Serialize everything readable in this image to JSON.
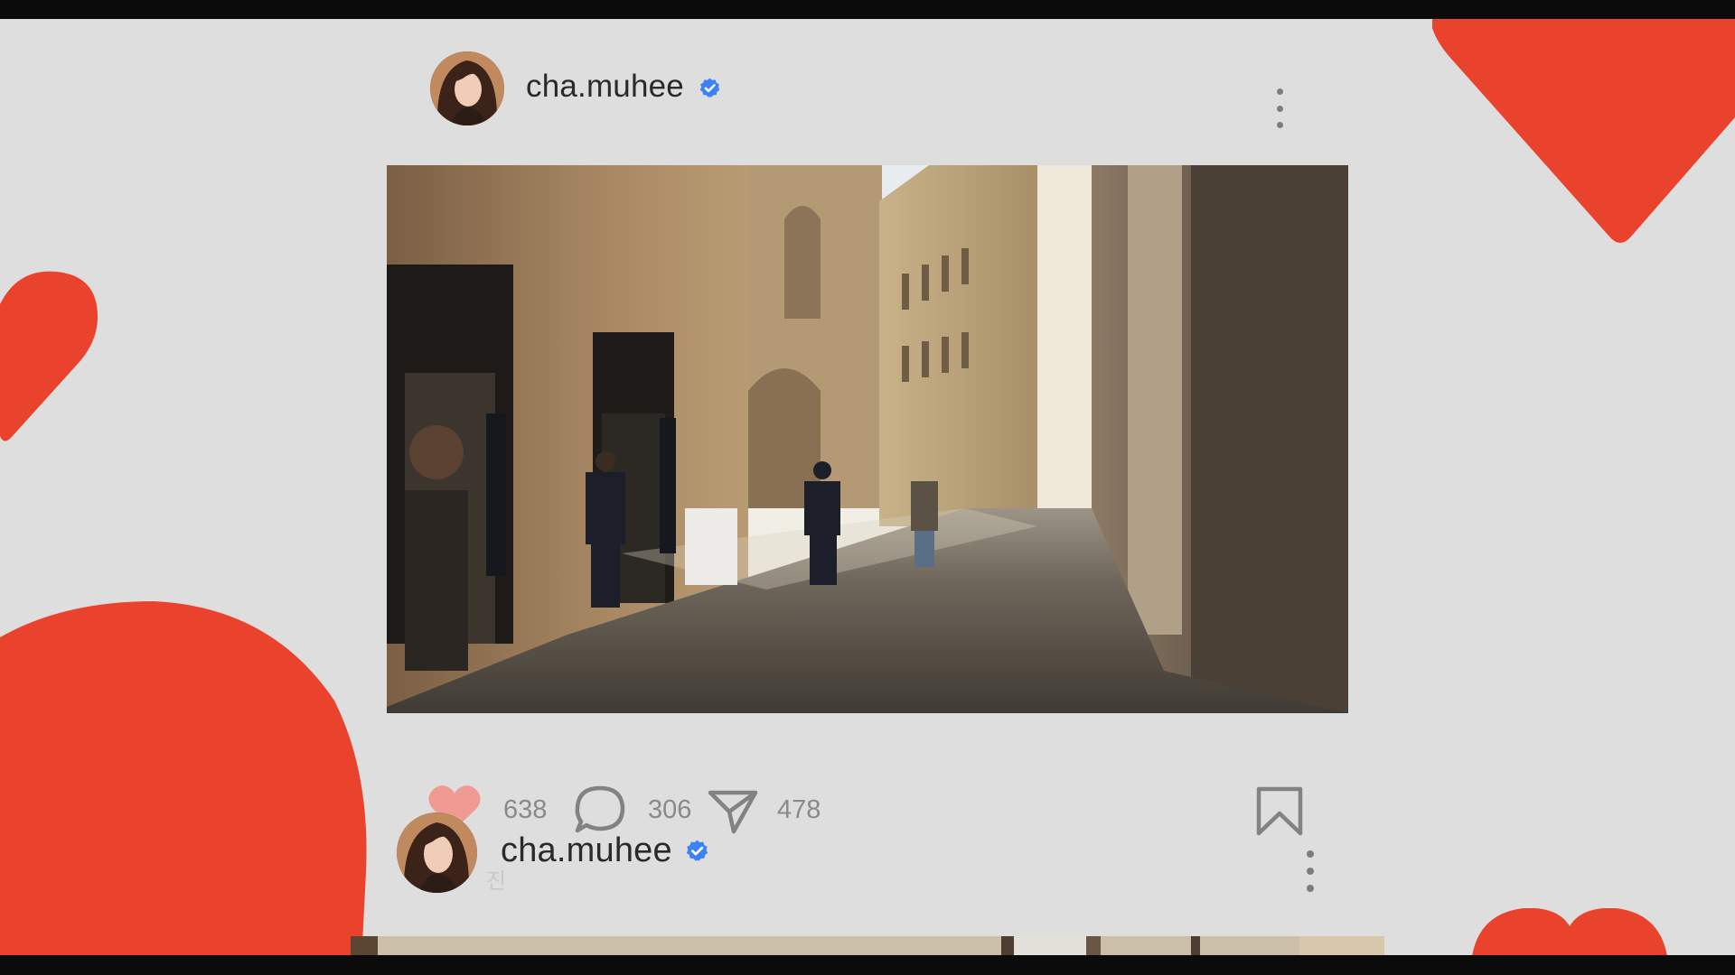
{
  "posts": [
    {
      "username": "cha.muhee",
      "verified": true
    },
    {
      "username": "cha.muhee",
      "verified": true
    }
  ],
  "actions": {
    "likes": "638",
    "comments": "306",
    "shares": "478"
  },
  "caption_fragment": "진",
  "colors": {
    "background": "#dedede",
    "heart_red": "#e9432d",
    "verified_blue": "#3b82f6",
    "like_icon": "#f09a94"
  },
  "icons": [
    "heart-icon",
    "comment-icon",
    "share-icon",
    "bookmark-icon",
    "more-options-icon",
    "verified-badge-icon"
  ]
}
